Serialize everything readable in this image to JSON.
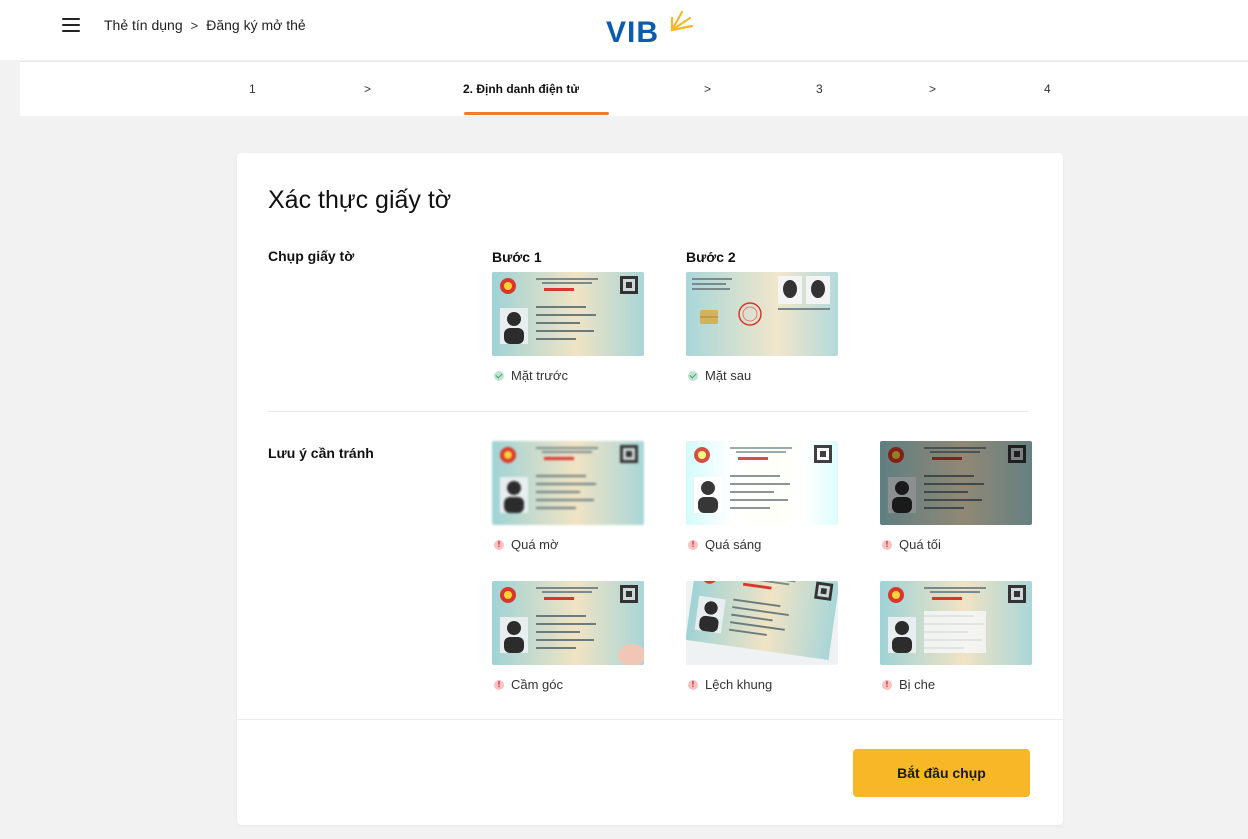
{
  "header": {
    "menu_icon": "menu-icon",
    "breadcrumb": [
      "Thẻ tín dụng",
      "Đăng ký mở thẻ"
    ],
    "breadcrumb_separator": ">",
    "logo_text": "VIB",
    "logo_color": "#0b5cad",
    "logo_star_color": "#f7b727"
  },
  "stepper": {
    "steps": [
      "1",
      "2. Định danh điện tử",
      "3",
      "4"
    ],
    "separator": ">",
    "active_index": 1,
    "accent_color": "#f07c2e"
  },
  "card": {
    "title": "Xác thực giấy tờ",
    "capture": {
      "label": "Chụp giấy tờ",
      "steps": [
        {
          "title": "Bước 1",
          "caption": "Mặt trước",
          "status": "ok"
        },
        {
          "title": "Bước 2",
          "caption": "Mặt sau",
          "status": "ok"
        }
      ]
    },
    "avoid": {
      "label": "Lưu ý cần tránh",
      "items": [
        {
          "caption": "Quá mờ",
          "status": "warning"
        },
        {
          "caption": "Quá sáng",
          "status": "warning"
        },
        {
          "caption": "Quá tối",
          "status": "warning"
        },
        {
          "caption": "Cầm góc",
          "status": "warning"
        },
        {
          "caption": "Lệch khung",
          "status": "warning"
        },
        {
          "caption": "Bị che",
          "status": "warning"
        }
      ]
    },
    "start_button": "Bắt đầu chụp",
    "button_color": "#f7b727"
  }
}
